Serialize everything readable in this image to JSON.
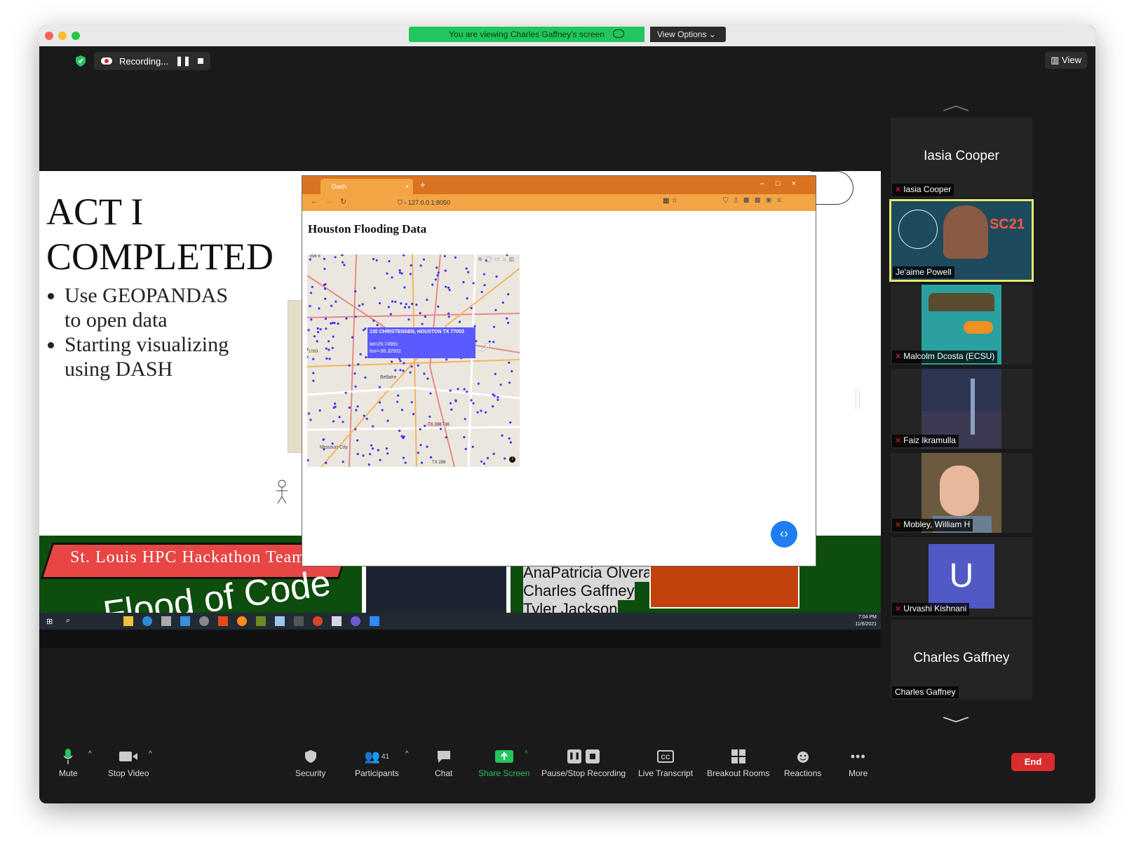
{
  "window": {
    "viewing_text": "You are viewing Charles Gaffney's screen",
    "view_options": "View Options",
    "recording_label": "Recording...",
    "view_button": "View"
  },
  "slide": {
    "title_line1": "ACT I",
    "title_line2": "COMPLETED",
    "bullets": [
      "Use GEOPANDAS",
      "to open data",
      "Starting visualizing",
      "using DASH"
    ],
    "banner_text": "St. Louis HPC Hackathon Team",
    "banner_logo_text": "Flood of Code",
    "team_names": [
      "AnaPatricia Olvera",
      "Charles Gaffney",
      "Tyler Jackson"
    ]
  },
  "browser": {
    "tab_label": "Dash",
    "url": "127.0.0.1:8050",
    "page_title": "Houston Flooding Data",
    "tooltip_address": "130 CHRISTENSEN, HOUSTON TX 77003",
    "tooltip_lat": "lat=29.74991",
    "tooltip_lon": "lon=-95.32932",
    "map_labels": [
      "Bellaire",
      "Missouri City",
      "TX 288 Toll",
      "TX 288",
      "1093",
      "BW 8"
    ]
  },
  "taskbar": {
    "time": "7:04 PM",
    "date": "11/6/2021"
  },
  "participants": [
    {
      "name": "Iasia Cooper",
      "big_name": "Iasia Cooper",
      "muted": true
    },
    {
      "name": "Je'aime Powell",
      "muted": false,
      "active": true
    },
    {
      "name": "Malcolm Dcosta (ECSU)",
      "muted": true
    },
    {
      "name": "Faiz Ikramulla",
      "muted": true
    },
    {
      "name": "Mobley, William H",
      "muted": true
    },
    {
      "name": "Urvashi Kishnani",
      "initial": "U",
      "muted": true
    },
    {
      "name": "Charles Gaffney",
      "big_name": "Charles Gaffney",
      "muted": false
    }
  ],
  "toolbar": {
    "mute": "Mute",
    "stop_video": "Stop Video",
    "security": "Security",
    "participants": "Participants",
    "participant_count": "41",
    "chat": "Chat",
    "share_screen": "Share Screen",
    "pause_stop_recording": "Pause/Stop Recording",
    "live_transcript": "Live Transcript",
    "breakout_rooms": "Breakout Rooms",
    "reactions": "Reactions",
    "more": "More",
    "end": "End"
  },
  "colors": {
    "share_green": "#22c55e",
    "end_red": "#d92c2c",
    "active_speaker": "#e8e86a",
    "map_points": "#3a3af0"
  }
}
